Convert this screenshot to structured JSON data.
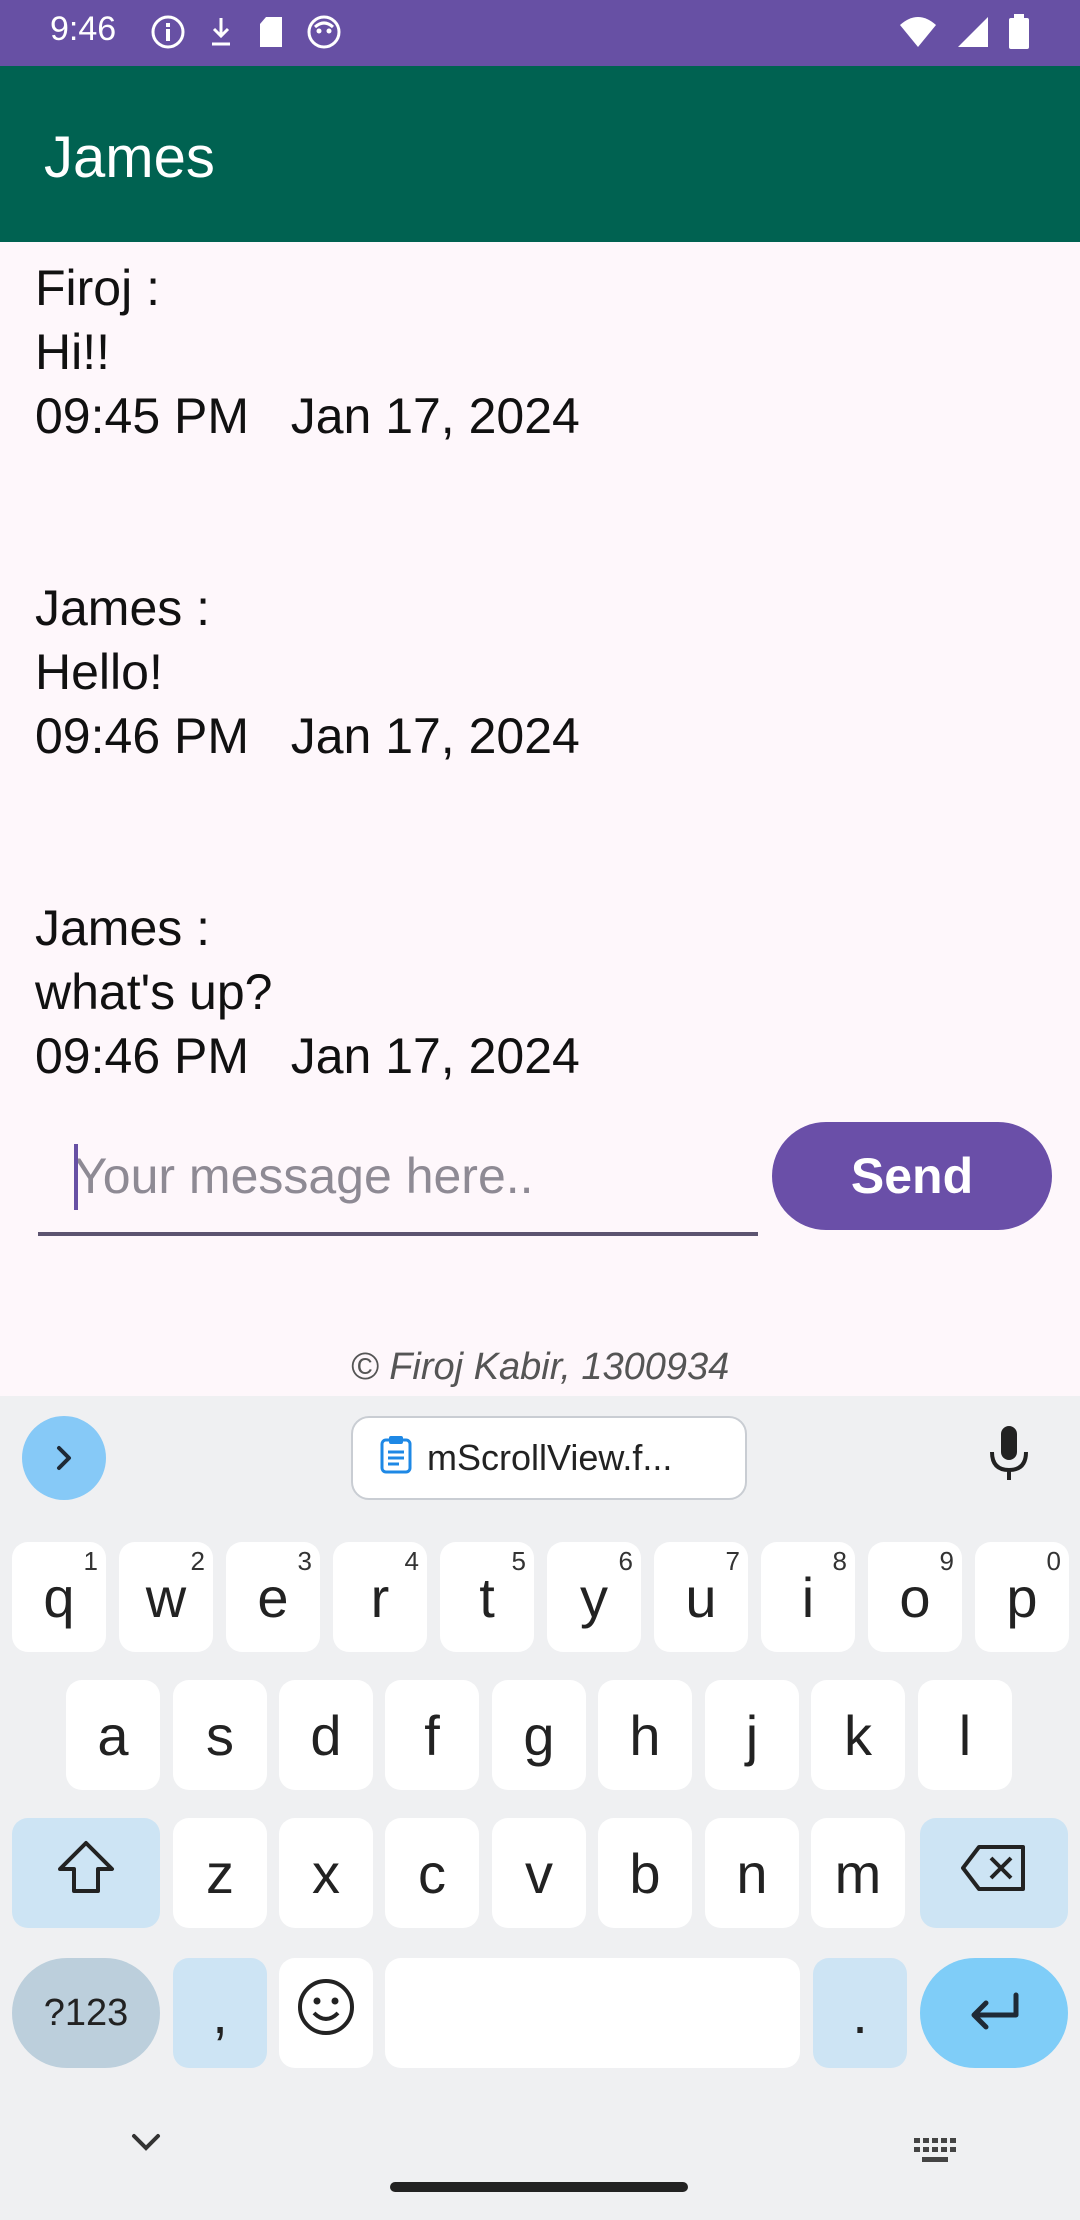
{
  "status_bar": {
    "time": "9:46"
  },
  "app_bar": {
    "title": "James"
  },
  "messages": [
    {
      "sender": "Firoj :",
      "text": "Hi!!",
      "timestamp": "09:45 PM   Jan 17, 2024"
    },
    {
      "sender": "James :",
      "text": "Hello!",
      "timestamp": "09:46 PM   Jan 17, 2024"
    },
    {
      "sender": "James :",
      "text": "what's up?",
      "timestamp": "09:46 PM   Jan 17, 2024"
    }
  ],
  "composer": {
    "placeholder": "Your message here..",
    "value": "",
    "send_label": "Send"
  },
  "footer": "© Firoj Kabir, 1300934",
  "keyboard": {
    "clipboard_chip": "mScrollView.f...",
    "row1": [
      {
        "key": "q",
        "sup": "1"
      },
      {
        "key": "w",
        "sup": "2"
      },
      {
        "key": "e",
        "sup": "3"
      },
      {
        "key": "r",
        "sup": "4"
      },
      {
        "key": "t",
        "sup": "5"
      },
      {
        "key": "y",
        "sup": "6"
      },
      {
        "key": "u",
        "sup": "7"
      },
      {
        "key": "i",
        "sup": "8"
      },
      {
        "key": "o",
        "sup": "9"
      },
      {
        "key": "p",
        "sup": "0"
      }
    ],
    "row2": [
      "a",
      "s",
      "d",
      "f",
      "g",
      "h",
      "j",
      "k",
      "l"
    ],
    "row3": [
      "z",
      "x",
      "c",
      "v",
      "b",
      "n",
      "m"
    ],
    "symbols_label": "?123",
    "comma": ",",
    "period": "."
  },
  "icons": [
    "info-icon",
    "download-icon",
    "sd-card-icon",
    "android-icon",
    "wifi-icon",
    "signal-icon",
    "battery-icon",
    "chevron-right-icon",
    "clipboard-icon",
    "microphone-icon",
    "shift-icon",
    "backspace-icon",
    "emoji-icon",
    "enter-icon",
    "chevron-down-icon",
    "keyboard-icon"
  ],
  "colors": {
    "status_bar": "#6750a4",
    "app_bar": "#006251",
    "send_button": "#6a4fa8",
    "enter_key": "#7fcdf8"
  }
}
